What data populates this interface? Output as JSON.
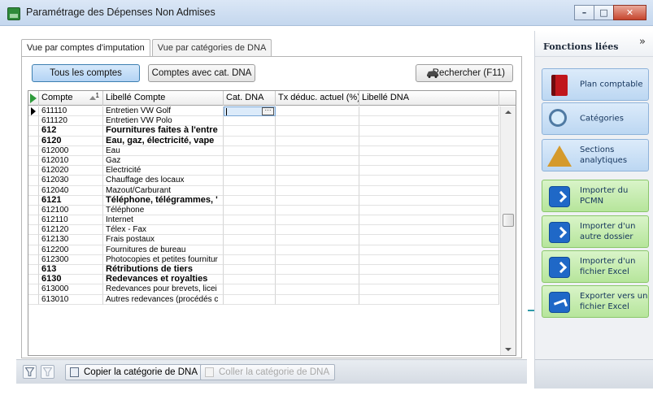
{
  "window": {
    "title": "Paramétrage des Dépenses Non Admises",
    "app_icon": "DOM app logo",
    "controls": [
      "minimize",
      "maximize",
      "close"
    ]
  },
  "tabs": [
    {
      "label": "Vue par comptes d'imputation",
      "active": true
    },
    {
      "label": "Vue par catégories de DNA",
      "active": false
    }
  ],
  "filter": {
    "all_label": "Tous les comptes",
    "dna_label": "Comptes avec cat. DNA",
    "search_label": "Rechercher (F11)"
  },
  "grid": {
    "headers": {
      "compte": "Compte",
      "sort_index": "1",
      "libelle": "Libellé Compte",
      "cat": "Cat. DNA",
      "tx": "Tx déduc. actuel (%)",
      "libdna": "Libellé DNA"
    },
    "rows": [
      {
        "compte": "611110",
        "libelle": "Entretien VW Golf",
        "bold": false,
        "current": true
      },
      {
        "compte": "611120",
        "libelle": "Entretien VW Polo",
        "bold": false
      },
      {
        "compte": "612",
        "libelle": "Fournitures faites à l'entre",
        "bold": true
      },
      {
        "compte": "6120",
        "libelle": "Eau, gaz, électricité, vape",
        "bold": true
      },
      {
        "compte": "612000",
        "libelle": "Eau",
        "bold": false
      },
      {
        "compte": "612010",
        "libelle": "Gaz",
        "bold": false
      },
      {
        "compte": "612020",
        "libelle": "Electricité",
        "bold": false
      },
      {
        "compte": "612030",
        "libelle": "Chauffage des locaux",
        "bold": false
      },
      {
        "compte": "612040",
        "libelle": "Mazout/Carburant",
        "bold": false
      },
      {
        "compte": "6121",
        "libelle": "Téléphone, télégrammes, '",
        "bold": true
      },
      {
        "compte": "612100",
        "libelle": "Téléphone",
        "bold": false
      },
      {
        "compte": "612110",
        "libelle": "Internet",
        "bold": false
      },
      {
        "compte": "612120",
        "libelle": "Télex - Fax",
        "bold": false
      },
      {
        "compte": "612130",
        "libelle": "Frais postaux",
        "bold": false
      },
      {
        "compte": "612200",
        "libelle": "Fournitures de bureau",
        "bold": false
      },
      {
        "compte": "612300",
        "libelle": "Photocopies et petites fournitur",
        "bold": false
      },
      {
        "compte": "613",
        "libelle": "Rétributions de tiers",
        "bold": true
      },
      {
        "compte": "6130",
        "libelle": "Redevances et royalties",
        "bold": true
      },
      {
        "compte": "613000",
        "libelle": "Redevances pour brevets, licei",
        "bold": false
      },
      {
        "compte": "613010",
        "libelle": "Autres redevances (procédés c",
        "bold": false
      }
    ]
  },
  "bottom_toolbar": {
    "copy_label": "Copier la catégorie de DNA",
    "paste_label": "Coller la catégorie de DNA"
  },
  "side_panel": {
    "title": "Fonctions liées",
    "items": [
      {
        "label": "Plan comptable",
        "icon": "book-icon",
        "color": "blue"
      },
      {
        "label": "Catégories",
        "icon": "magnifier-icon",
        "color": "blue"
      },
      {
        "label": "Sections analytiques",
        "icon": "pyramid-icon",
        "color": "blue"
      },
      {
        "label": "Importer du PCMN",
        "icon": "import-arrow-icon",
        "color": "green"
      },
      {
        "label": "Importer d'un autre dossier",
        "icon": "import-arrow-icon",
        "color": "green"
      },
      {
        "label": "Importer d'un fichier Excel",
        "icon": "import-arrow-icon",
        "color": "green"
      },
      {
        "label": "Exporter vers un fichier Excel",
        "icon": "export-arrow-icon",
        "color": "green"
      }
    ]
  },
  "colors": {
    "selected_filter": "#b3d3f4",
    "side_blue": "#bcd7f2",
    "side_green": "#b6e59b",
    "grid_edit": "#dcebfa"
  }
}
